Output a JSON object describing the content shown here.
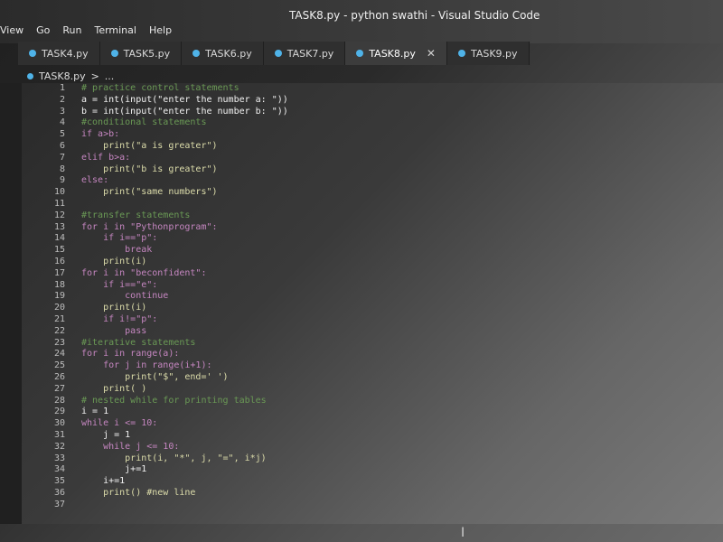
{
  "window": {
    "title": "TASK8.py - python swathi - Visual Studio Code"
  },
  "menu": [
    "View",
    "Go",
    "Run",
    "Terminal",
    "Help"
  ],
  "tabs": [
    {
      "label": "TASK4.py",
      "active": false
    },
    {
      "label": "TASK5.py",
      "active": false
    },
    {
      "label": "TASK6.py",
      "active": false
    },
    {
      "label": "TASK7.py",
      "active": false
    },
    {
      "label": "TASK8.py",
      "active": true
    },
    {
      "label": "TASK9.py",
      "active": false
    }
  ],
  "breadcrumb": [
    "TASK8.py",
    ">",
    "..."
  ],
  "editor": {
    "line_numbers": [
      "1",
      "2",
      "3",
      "4",
      "5",
      "6",
      "7",
      "8",
      "9",
      "10",
      "11",
      "12",
      "13",
      "14",
      "15",
      "16",
      "17",
      "18",
      "19",
      "20",
      "21",
      "22",
      "23",
      "24",
      "25",
      "26",
      "27",
      "28",
      "29",
      "30",
      "31",
      "32",
      "33",
      "34",
      "35",
      "36",
      "37"
    ],
    "lines": [
      "# practice control statements",
      "a = int(input(\"enter the number a: \"))",
      "b = int(input(\"enter the number b: \"))",
      "#conditional statements",
      "if a>b:",
      "    print(\"a is greater\")",
      "elif b>a:",
      "    print(\"b is greater\")",
      "else:",
      "    print(\"same numbers\")",
      "",
      "#transfer statements",
      "for i in \"Pythonprogram\":",
      "    if i==\"p\":",
      "        break",
      "    print(i)",
      "for i in \"beconfident\":",
      "    if i==\"e\":",
      "        continue",
      "    print(i)",
      "    if i!=\"p\":",
      "        pass",
      "#iterative statements",
      "for i in range(a):",
      "    for j in range(i+1):",
      "        print(\"$\", end=' ')",
      "    print( )",
      "# nested while for printing tables",
      "i = 1",
      "while i <= 10:",
      "    j = 1",
      "    while j <= 10:",
      "        print(i, \"*\", j, \"=\", i*j)",
      "        j+=1",
      "    i+=1",
      "    print() #new line",
      ""
    ]
  },
  "icons": {
    "tab_file_icon": "python-file-icon",
    "close_icon": "close-icon",
    "mouse_cursor": "ibeam-cursor-icon"
  },
  "colors": {
    "python_icon": "#4fb3e8",
    "keyword": "#c586c0",
    "function": "#dcdcaa",
    "string": "#ce9178",
    "comment": "#6a9955"
  }
}
